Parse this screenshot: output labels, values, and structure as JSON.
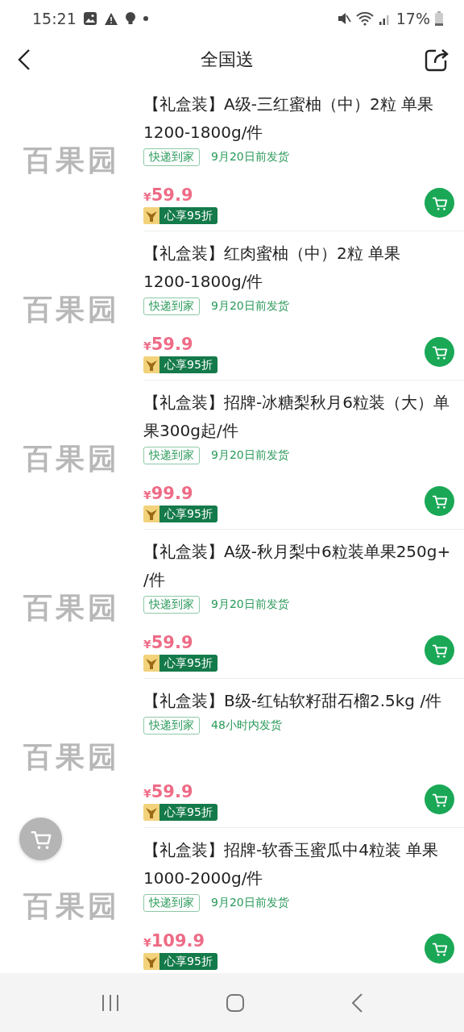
{
  "status_bar": {
    "time": "15:21",
    "battery": "17%"
  },
  "header": {
    "title": "全国送"
  },
  "products": [
    {
      "image_logo": "百果园",
      "title": "【礼盒装】A级-三红蜜柚（中）2粒 单果1200-1800g/件",
      "tag": "快递到家",
      "shipping": "9月20日前发货",
      "price_symbol": "¥",
      "price": "59.9",
      "member_badge": "心享95折"
    },
    {
      "image_logo": "百果园",
      "title": "【礼盒装】红肉蜜柚（中）2粒 单果1200-1800g/件",
      "tag": "快递到家",
      "shipping": "9月20日前发货",
      "price_symbol": "¥",
      "price": "59.9",
      "member_badge": "心享95折"
    },
    {
      "image_logo": "百果园",
      "title": "【礼盒装】招牌-冰糖梨秋月6粒装（大）单果300g起/件",
      "tag": "快递到家",
      "shipping": "9月20日前发货",
      "price_symbol": "¥",
      "price": "99.9",
      "member_badge": "心享95折"
    },
    {
      "image_logo": "百果园",
      "title": "【礼盒装】A级-秋月梨中6粒装单果250g+ /件",
      "tag": "快递到家",
      "shipping": "9月20日前发货",
      "price_symbol": "¥",
      "price": "59.9",
      "member_badge": "心享95折"
    },
    {
      "image_logo": "百果园",
      "title": "【礼盒装】B级-红钻软籽甜石榴2.5kg /件",
      "tag": "快递到家",
      "shipping": "48小时内发货",
      "price_symbol": "¥",
      "price": "59.9",
      "member_badge": "心享95折"
    },
    {
      "image_logo": "百果园",
      "title": "【礼盒装】招牌-软香玉蜜瓜中4粒装 单果1000-2000g/件",
      "tag": "快递到家",
      "shipping": "9月20日前发货",
      "price_symbol": "¥",
      "price": "109.9",
      "member_badge": "心享95折"
    }
  ]
}
